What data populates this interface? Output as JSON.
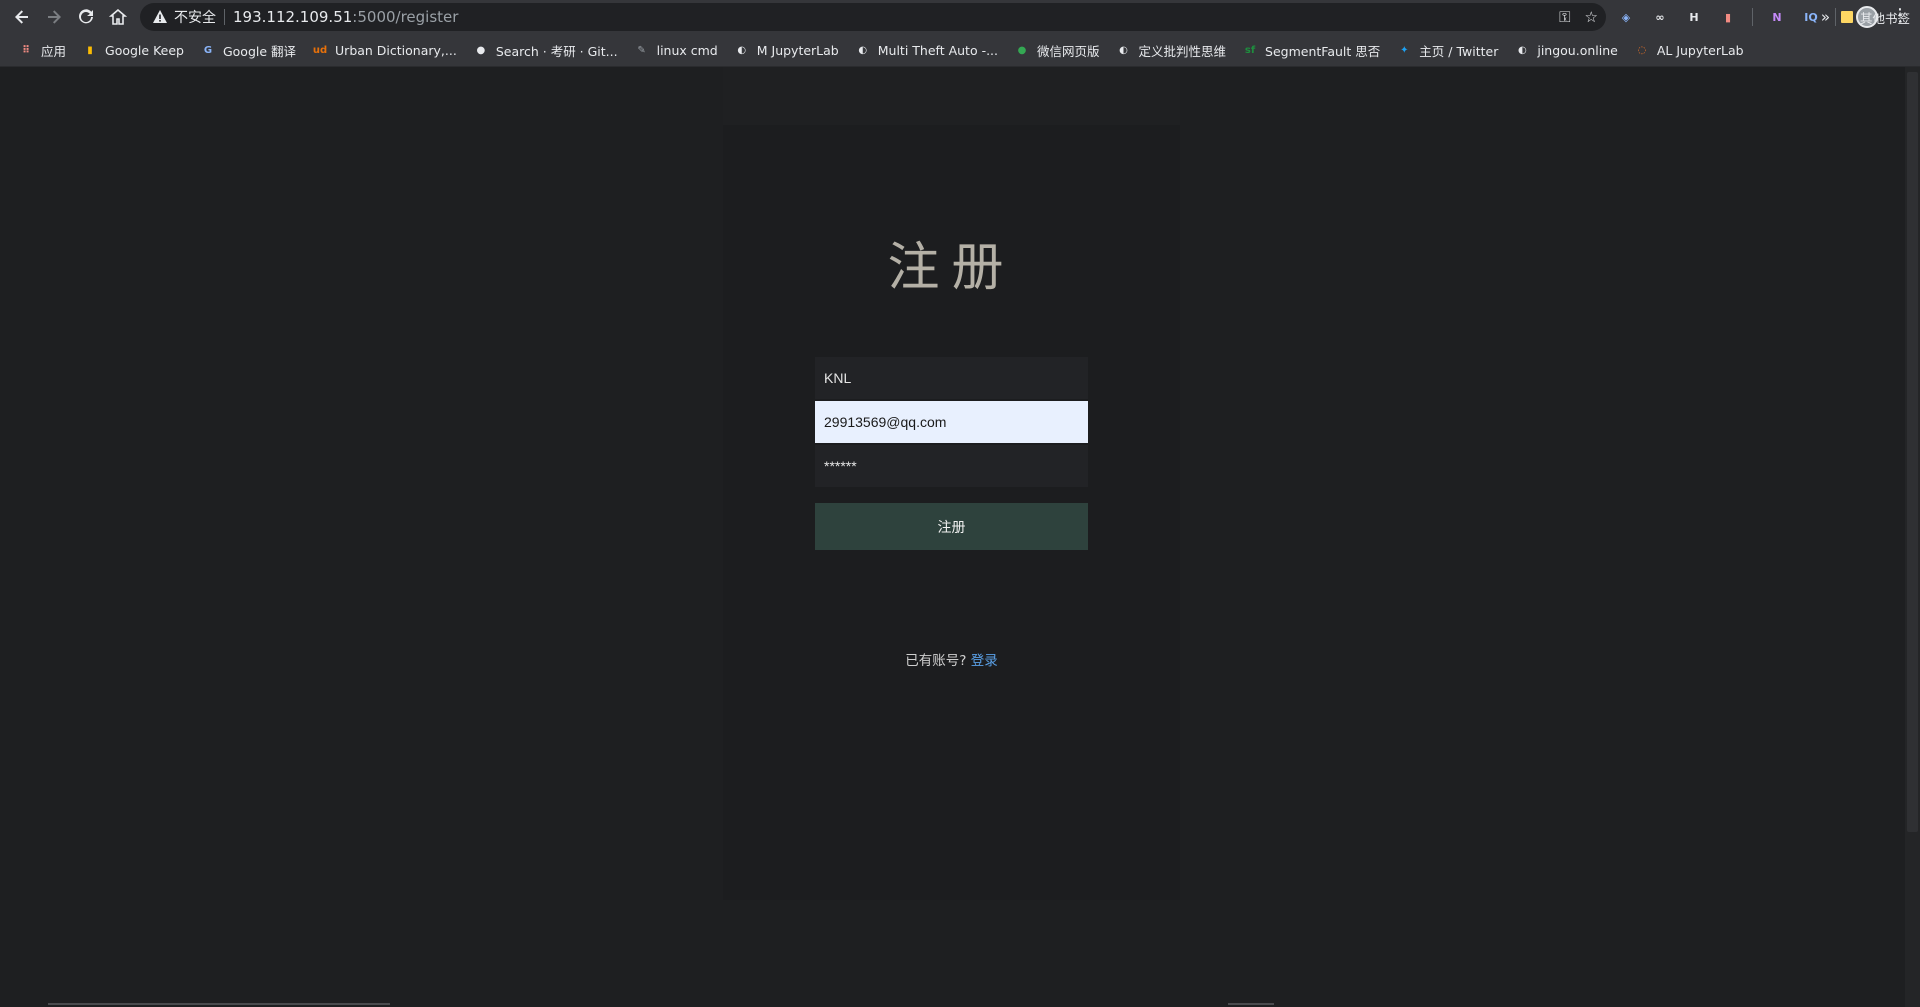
{
  "browser": {
    "security_label": "不安全",
    "url_host": "193.112.109.51",
    "url_rest": ":5000/register",
    "extensions": [
      {
        "name": "extension-shield-icon",
        "glyph": "◈",
        "color": "#8ab4f8"
      },
      {
        "name": "extension-glasses-icon",
        "glyph": "∞",
        "color": "#e8eaed"
      },
      {
        "name": "extension-h-icon",
        "glyph": "H",
        "color": "#e8eaed"
      },
      {
        "name": "extension-bookmark-icon",
        "glyph": "▮",
        "color": "#f28b82"
      },
      {
        "name": "extension-onenote-icon",
        "glyph": "N",
        "color": "#c58af9"
      },
      {
        "name": "extension-iq-icon",
        "glyph": "IQ",
        "color": "#8ab4f8"
      }
    ]
  },
  "bookmarks": [
    {
      "label": "应用",
      "icon": "apps-grid-icon",
      "glyph": "⠿",
      "color": "#f28b82"
    },
    {
      "label": "Google Keep",
      "icon": "keep-icon",
      "glyph": "▮",
      "color": "#fbbc04"
    },
    {
      "label": "Google 翻译",
      "icon": "translate-icon",
      "glyph": "G",
      "color": "#8ab4f8"
    },
    {
      "label": "Urban Dictionary,...",
      "icon": "urban-dictionary-icon",
      "glyph": "ud",
      "color": "#e8710a"
    },
    {
      "label": "Search · 考研 · Git...",
      "icon": "github-icon",
      "glyph": "●",
      "color": "#e8eaed"
    },
    {
      "label": "linux cmd",
      "icon": "linux-cmd-icon",
      "glyph": "✎",
      "color": "#9aa0a6"
    },
    {
      "label": "M JupyterLab",
      "icon": "globe-icon",
      "glyph": "◐",
      "color": "#e8eaed"
    },
    {
      "label": "Multi Theft Auto -...",
      "icon": "globe-icon",
      "glyph": "◐",
      "color": "#e8eaed"
    },
    {
      "label": "微信网页版",
      "icon": "wechat-icon",
      "glyph": "●",
      "color": "#34a853"
    },
    {
      "label": "定义批判性思维",
      "icon": "globe-icon",
      "glyph": "◐",
      "color": "#e8eaed"
    },
    {
      "label": "SegmentFault 思否",
      "icon": "segmentfault-icon",
      "glyph": "sf",
      "color": "#1e8e3e"
    },
    {
      "label": "主页 / Twitter",
      "icon": "twitter-icon",
      "glyph": "✦",
      "color": "#1da1f2"
    },
    {
      "label": "jingou.online",
      "icon": "globe-icon",
      "glyph": "◐",
      "color": "#e8eaed"
    },
    {
      "label": "AL JupyterLab",
      "icon": "jupyter-icon",
      "glyph": "◌",
      "color": "#f37626"
    }
  ],
  "bookmarks_more": "»",
  "bookmarks_other": "其他书签",
  "form": {
    "title": "注册",
    "username_value": "KNL",
    "email_value": "29913569@qq.com",
    "password_value": "******",
    "submit_label": "注册",
    "login_prompt": "已有账号?",
    "login_link": "登录"
  }
}
